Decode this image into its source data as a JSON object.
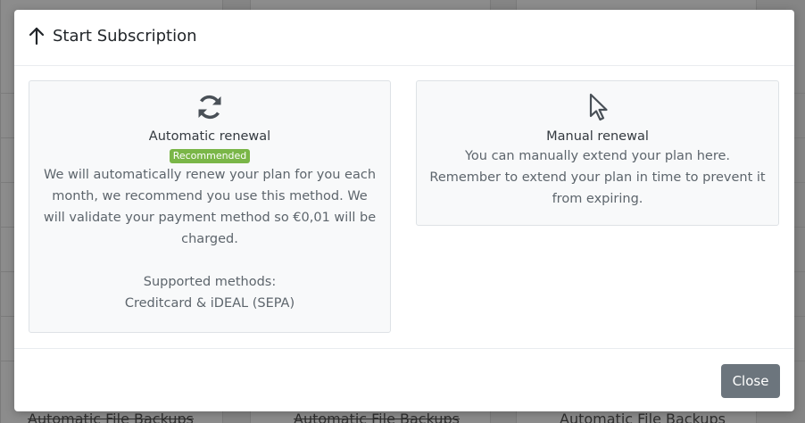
{
  "modal": {
    "title": "Start Subscription",
    "icon": "arrow-up-icon",
    "close_label": "Close"
  },
  "options": {
    "automatic": {
      "icon": "sync-icon",
      "title": "Automatic renewal",
      "badge": "Recommended",
      "badge_color": "#7ab648",
      "description": "We will automatically renew your plan for you each month, we recommend you use this method. We will validate your payment method so €0,01 will be charged.",
      "methods_label": "Supported methods:",
      "methods": "Creditcard & iDEAL (SEPA)"
    },
    "manual": {
      "icon": "pointer-icon",
      "title": "Manual renewal",
      "description": "You can manually extend your plan here. Remember to extend your plan in time to prevent it from expiring."
    }
  },
  "background": {
    "footer_items": [
      "Automatic File Backups",
      "Automatic File Backups",
      "Automatic File Backups"
    ]
  },
  "colors": {
    "close_button": "#6c757d",
    "card_background": "#f8f9fa"
  }
}
